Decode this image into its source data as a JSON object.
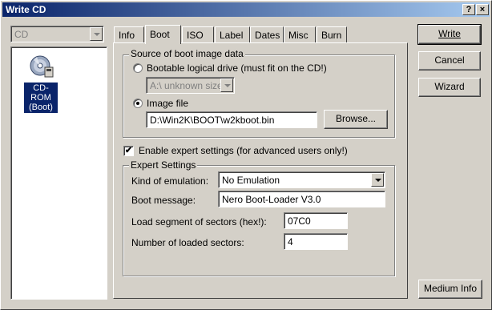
{
  "window": {
    "title": "Write CD",
    "help_btn": "?",
    "close_btn": "×"
  },
  "left": {
    "drive_select": "CD",
    "item_label_line1": "CD-ROM",
    "item_label_line2": "(Boot)",
    "item_icon": "cd-rom-icon"
  },
  "tabs": [
    {
      "label": "Info",
      "active": false
    },
    {
      "label": "Boot",
      "active": true
    },
    {
      "label": "ISO",
      "active": false
    },
    {
      "label": "Label",
      "active": false
    },
    {
      "label": "Dates",
      "active": false
    },
    {
      "label": "Misc",
      "active": false
    },
    {
      "label": "Burn",
      "active": false
    }
  ],
  "boot": {
    "source_group_label": "Source of boot image data",
    "radio_bootable_label": "Bootable logical drive (must fit on the CD!)",
    "drive_value": "A:\\  unknown size",
    "radio_image_label": "Image file",
    "image_path": "D:\\Win2K\\BOOT\\w2kboot.bin",
    "browse_label": "Browse...",
    "expert_checkbox_label": "Enable expert settings (for advanced users only!)",
    "expert_checked": true,
    "expert_group_label": "Expert Settings",
    "emulation_label": "Kind of emulation:",
    "emulation_value": "No Emulation",
    "boot_message_label": "Boot message:",
    "boot_message_value": "Nero Boot-Loader V3.0",
    "load_segment_label": "Load segment of sectors (hex!):",
    "load_segment_value": "07C0",
    "loaded_sectors_label": "Number of loaded sectors:",
    "loaded_sectors_value": "4"
  },
  "buttons": {
    "write": "Write",
    "cancel": "Cancel",
    "wizard": "Wizard",
    "medium_info": "Medium Info"
  },
  "checkmark": "✔"
}
